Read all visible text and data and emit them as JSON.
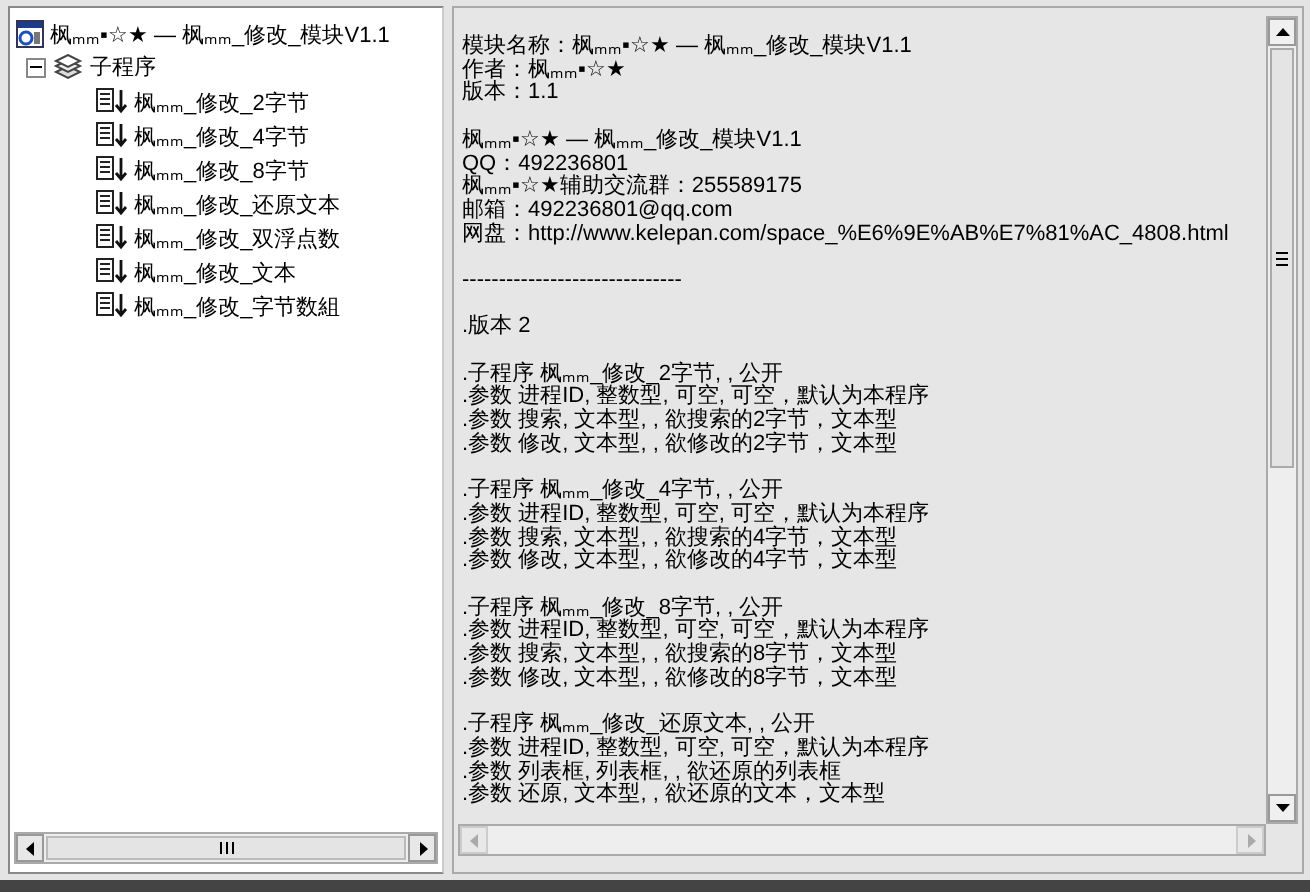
{
  "tree": {
    "label": "枫ₘₘ▪☆★ — 枫ₘₘ_修改_模块V1.1",
    "children": [
      {
        "label": "子程序",
        "expanded": true,
        "children": [
          {
            "label": "枫ₘₘ_修改_2字节"
          },
          {
            "label": "枫ₘₘ_修改_4字节"
          },
          {
            "label": "枫ₘₘ_修改_8字节"
          },
          {
            "label": "枫ₘₘ_修改_还原文本"
          },
          {
            "label": "枫ₘₘ_修改_双浮点数"
          },
          {
            "label": "枫ₘₘ_修改_文本"
          },
          {
            "label": "枫ₘₘ_修改_字节数組"
          }
        ]
      }
    ]
  },
  "info": {
    "blocks": [
      [
        "模块名称：枫ₘₘ▪☆★ — 枫ₘₘ_修改_模块V1.1",
        "作者：枫ₘₘ▪☆★",
        "版本：1.1"
      ],
      [
        "枫ₘₘ▪☆★ — 枫ₘₘ_修改_模块V1.1",
        "QQ：492236801",
        "枫ₘₘ▪☆★辅助交流群：255589175",
        "邮箱：492236801@qq.com",
        "网盘：http://www.kelepan.com/space_%E6%9E%AB%E7%81%AC_4808.html"
      ],
      [
        "------------------------------"
      ],
      [
        ".版本 2"
      ],
      [
        ".子程序 枫ₘₘ_修改_2字节, , 公开",
        ".参数 进程ID, 整数型, 可空, 可空，默认为本程序",
        ".参数 搜索, 文本型, , 欲搜索的2字节，文本型",
        ".参数 修改, 文本型, , 欲修改的2字节，文本型"
      ],
      [
        ".子程序 枫ₘₘ_修改_4字节, , 公开",
        ".参数 进程ID, 整数型, 可空, 可空，默认为本程序",
        ".参数 搜索, 文本型, , 欲搜索的4字节，文本型",
        ".参数 修改, 文本型, , 欲修改的4字节，文本型"
      ],
      [
        ".子程序 枫ₘₘ_修改_8字节, , 公开",
        ".参数 进程ID, 整数型, 可空, 可空，默认为本程序",
        ".参数 搜索, 文本型, , 欲搜索的8字节，文本型",
        ".参数 修改, 文本型, , 欲修改的8字节，文本型"
      ],
      [
        ".子程序 枫ₘₘ_修改_还原文本, , 公开",
        ".参数 进程ID, 整数型, 可空, 可空，默认为本程序",
        ".参数 列表框, 列表框, , 欲还原的列表框",
        ".参数 还原, 文本型, , 欲还原的文本，文本型"
      ]
    ]
  }
}
